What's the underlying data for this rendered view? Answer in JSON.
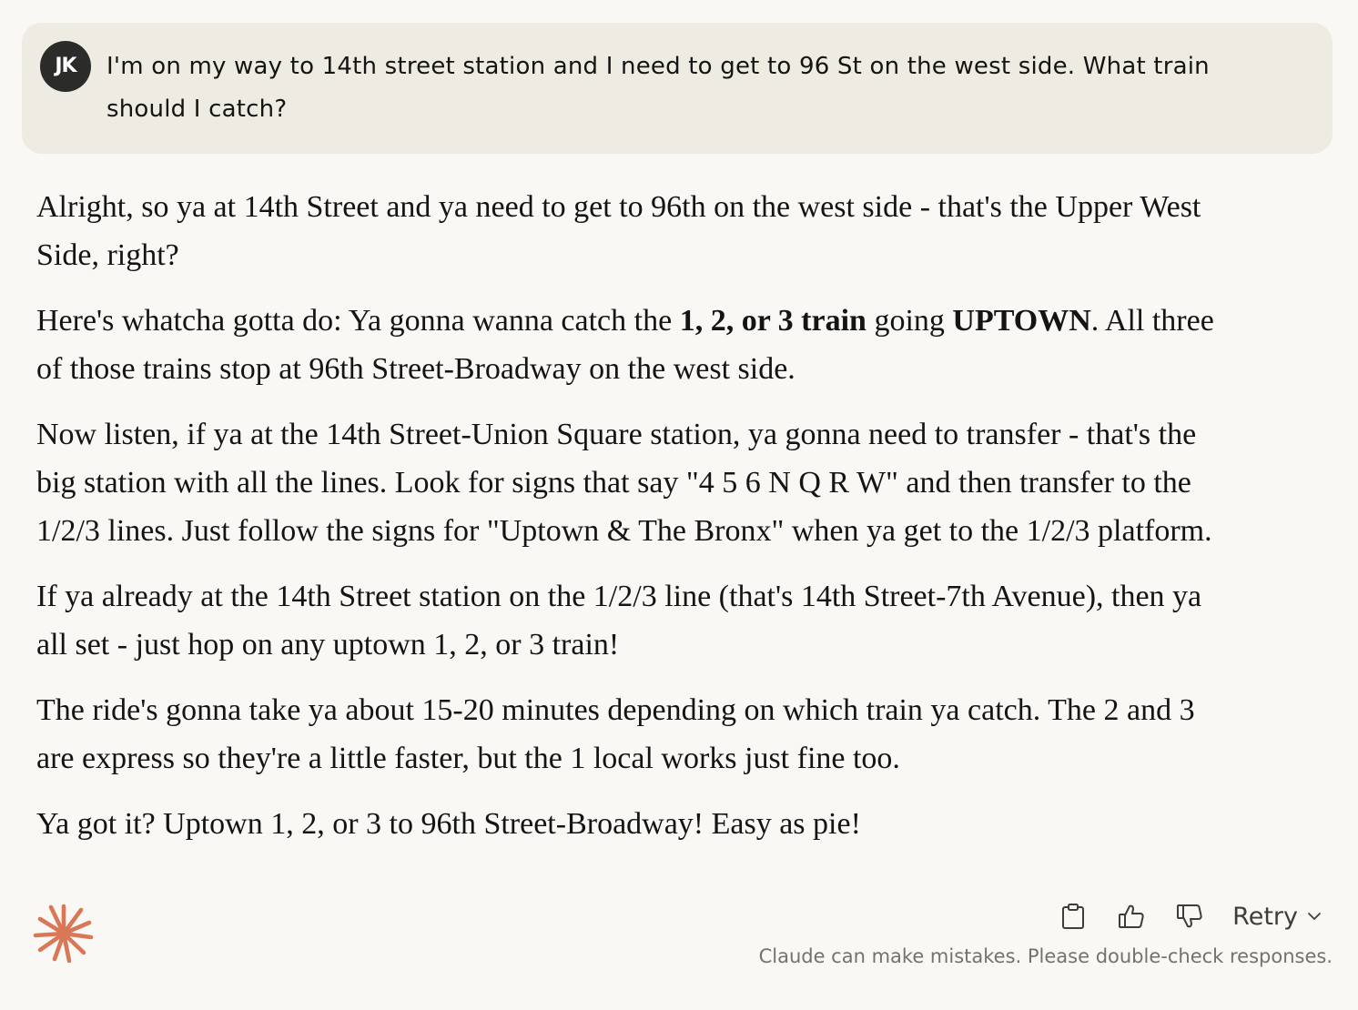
{
  "user_message": {
    "avatar_initials": "JK",
    "line1": "I'm on my way to 14th street station and I need to get to 96 St on the west side. What train",
    "line2": "should I catch?"
  },
  "assistant_message": {
    "p1": {
      "line1": "Alright, so ya at 14th Street and ya need to get to 96th on the west side - that's the Upper West",
      "line2": "Side, right?"
    },
    "p2": {
      "line1_pre": "Here's whatcha gotta do: Ya gonna wanna catch the ",
      "line1_bold1": "1, 2, or 3 train",
      "line1_mid": " going ",
      "line1_bold2": "UPTOWN",
      "line1_post": ". All three",
      "line2": "of those trains stop at 96th Street-Broadway on the west side."
    },
    "p3": {
      "line1": "Now listen, if ya at the 14th Street-Union Square station, ya gonna need to transfer - that's the",
      "line2": "big station with all the lines. Look for signs that say \"4 5 6 N Q R W\" and then transfer to the",
      "line3": "1/2/3 lines. Just follow the signs for \"Uptown & The Bronx\" when ya get to the 1/2/3 platform."
    },
    "p4": {
      "line1": "If ya already at the 14th Street station on the 1/2/3 line (that's 14th Street-7th Avenue), then ya",
      "line2": "all set - just hop on any uptown 1, 2, or 3 train!"
    },
    "p5": {
      "line1": "The ride's gonna take ya about 15-20 minutes depending on which train ya catch. The 2 and 3",
      "line2": "are express so they're a little faster, but the 1 local works just fine too."
    },
    "p6": {
      "line1": "Ya got it? Uptown 1, 2, or 3 to 96th Street-Broadway! Easy as pie!"
    }
  },
  "footer": {
    "retry_label": "Retry",
    "disclaimer": "Claude can make mistakes. Please double-check responses."
  },
  "icons": {
    "copy": "clipboard-icon",
    "thumbs_up": "thumbs-up-icon",
    "thumbs_down": "thumbs-down-icon",
    "retry_dropdown": "chevron-down-icon",
    "logo": "claude-spark-logo"
  },
  "colors": {
    "background": "#f9f8f5",
    "user_bubble": "#eeebe3",
    "avatar": "#2b2b29",
    "logo": "#d97757",
    "text": "#141413",
    "muted": "#73726c"
  }
}
